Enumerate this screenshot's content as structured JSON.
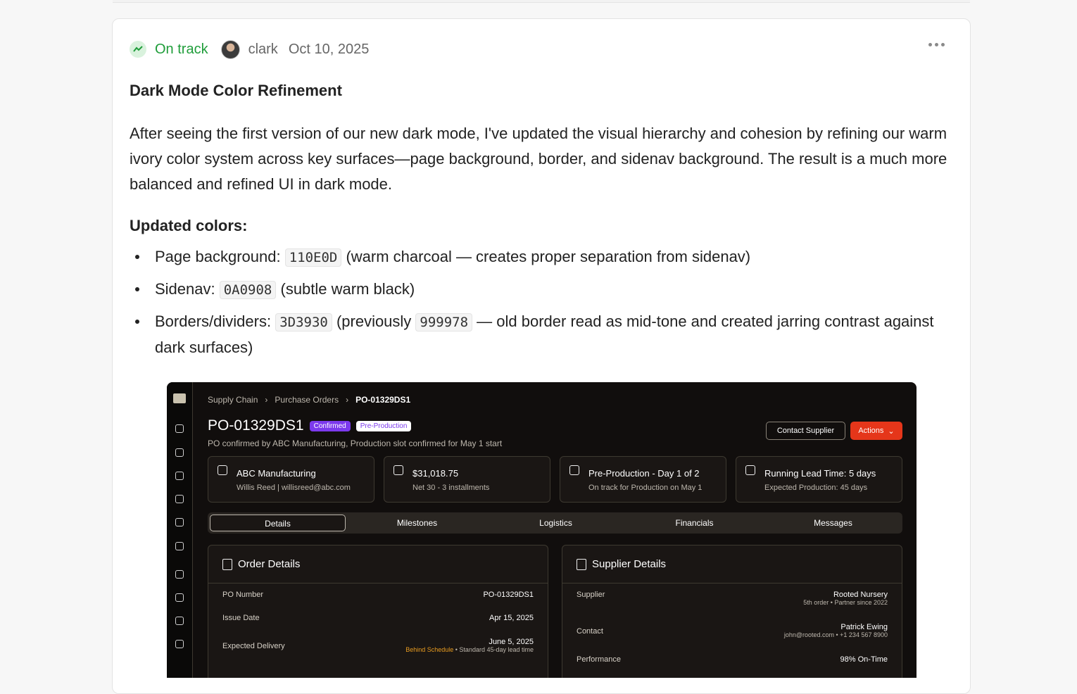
{
  "post": {
    "status": "On track",
    "author": "clark",
    "date": "Oct 10, 2025",
    "title": "Dark Mode Color Refinement",
    "body": "After seeing the first version of our new dark mode, I've updated the visual hierarchy and cohesion by refining our warm ivory color system across key surfaces—page background, border, and sidenav background. The result is a much more balanced and refined UI in dark mode.",
    "subhead": "Updated colors:",
    "items": [
      {
        "label": "Page background: ",
        "code": "110E0D",
        "after": " (warm charcoal — creates proper separation from sidenav)"
      },
      {
        "label": "Sidenav: ",
        "code": "0A0908",
        "after": " (subtle warm black)"
      },
      {
        "label": "Borders/dividers: ",
        "code": "3D3930",
        "mid": " (previously ",
        "code2": "999978",
        "after": " — old border read as mid-tone and created jarring contrast against dark surfaces)"
      }
    ]
  },
  "shot": {
    "crumbs": [
      "Supply Chain",
      "Purchase Orders",
      "PO-01329DS1"
    ],
    "po": "PO-01329DS1",
    "badge_confirmed": "Confirmed",
    "badge_pre": "Pre-Production",
    "subtitle": "PO confirmed by ABC Manufacturing, Production slot confirmed for May 1 start",
    "contact_btn": "Contact Supplier",
    "actions_btn": "Actions",
    "stats": [
      {
        "l1": "ABC Manufacturing",
        "l2": "Willis Reed | willisreed@abc.com"
      },
      {
        "l1": "$31,018.75",
        "l2": "Net 30 - 3 installments"
      },
      {
        "l1": "Pre-Production - Day 1 of 2",
        "l2": "On track for Production on May 1"
      },
      {
        "l1": "Running Lead Time: 5 days",
        "l2": "Expected Production: 45 days"
      }
    ],
    "tabs": [
      "Details",
      "Milestones",
      "Logistics",
      "Financials",
      "Messages"
    ],
    "order": {
      "title": "Order Details",
      "po_label": "PO Number",
      "po_value": "PO-01329DS1",
      "issue_label": "Issue Date",
      "issue_value": "Apr 15, 2025",
      "delivery_label": "Expected Delivery",
      "delivery_value": "June 5, 2025",
      "delivery_warn": "Behind Schedule",
      "delivery_note": " • Standard 45-day lead time"
    },
    "supplier": {
      "title": "Supplier Details",
      "supplier_label": "Supplier",
      "supplier_value": "Rooted Nursery",
      "supplier_note": "5th order • Partner since 2022",
      "contact_label": "Contact",
      "contact_value": "Patrick Ewing",
      "contact_note": "john@rooted.com • +1 234 567 8900",
      "perf_label": "Performance",
      "perf_value": "98% On-Time"
    },
    "colors": {
      "page": "#110E0D",
      "sidenav": "#0A0908",
      "border": "#3D3930",
      "accent": "#e5361a",
      "purple": "#7c3aed"
    }
  }
}
